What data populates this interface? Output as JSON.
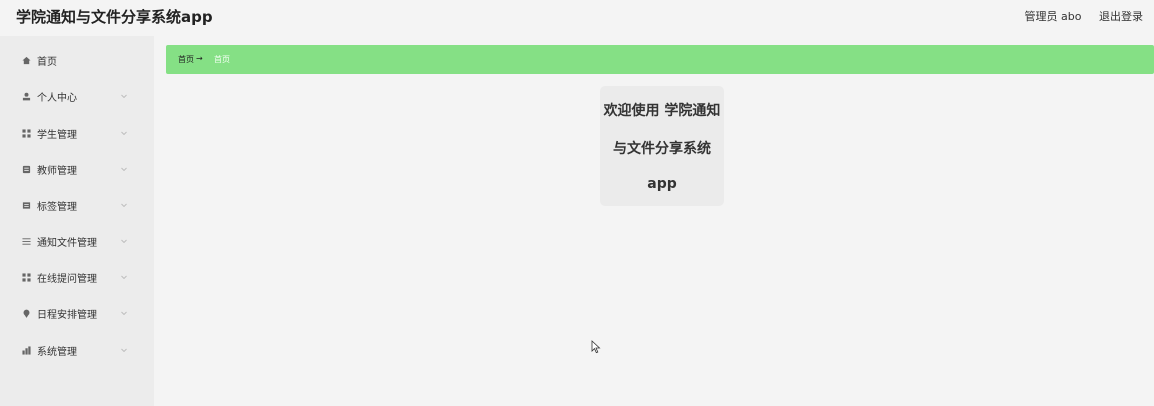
{
  "app": {
    "title": "学院通知与文件分享系统app"
  },
  "header": {
    "user_text": "管理员 abo",
    "logout_label": "退出登录"
  },
  "sidebar": {
    "items": [
      {
        "label": "首页",
        "icon": "home-icon",
        "has_submenu": false
      },
      {
        "label": "个人中心",
        "icon": "person-icon",
        "has_submenu": true
      },
      {
        "label": "学生管理",
        "icon": "grid-icon",
        "has_submenu": true
      },
      {
        "label": "教师管理",
        "icon": "book-icon",
        "has_submenu": true
      },
      {
        "label": "标签管理",
        "icon": "tag-icon",
        "has_submenu": true
      },
      {
        "label": "通知文件管理",
        "icon": "list-icon",
        "has_submenu": true
      },
      {
        "label": "在线提问管理",
        "icon": "grid-icon",
        "has_submenu": true
      },
      {
        "label": "日程安排管理",
        "icon": "pin-icon",
        "has_submenu": true
      },
      {
        "label": "系统管理",
        "icon": "settings-icon",
        "has_submenu": true
      }
    ]
  },
  "breadcrumb": {
    "home": "首页",
    "separator": "→",
    "current": "首页"
  },
  "welcome": {
    "line1": "欢迎使用 学院通知",
    "line2": "与文件分享系统",
    "line3": "app"
  },
  "colors": {
    "breadcrumb_bg": "#85e085",
    "page_bg": "#f4f4f4",
    "sidebar_bg": "#ececec"
  }
}
